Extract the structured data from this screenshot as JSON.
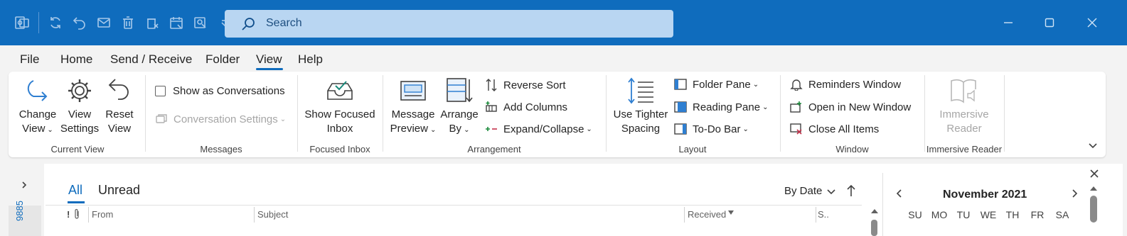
{
  "search": {
    "placeholder": "Search"
  },
  "menu": [
    "File",
    "Home",
    "Send / Receive",
    "Folder",
    "View",
    "Help"
  ],
  "ribbon": {
    "current_view": {
      "change_view": [
        "Change",
        "View"
      ],
      "view_settings": [
        "View",
        "Settings"
      ],
      "reset_view": [
        "Reset",
        "View"
      ],
      "label": "Current View"
    },
    "messages": {
      "show_as_conversations": "Show as Conversations",
      "conversation_settings": "Conversation Settings",
      "label": "Messages"
    },
    "focused_inbox": {
      "show_focused_inbox": [
        "Show Focused",
        "Inbox"
      ],
      "label": "Focused Inbox"
    },
    "arrangement": {
      "message_preview": [
        "Message",
        "Preview"
      ],
      "arrange_by": [
        "Arrange",
        "By"
      ],
      "reverse_sort": "Reverse Sort",
      "add_columns": "Add Columns",
      "expand_collapse": "Expand/Collapse",
      "label": "Arrangement"
    },
    "layout": {
      "use_tighter_spacing": [
        "Use Tighter",
        "Spacing"
      ],
      "folder_pane": "Folder Pane",
      "reading_pane": "Reading Pane",
      "todo_bar": "To-Do Bar",
      "label": "Layout"
    },
    "window": {
      "reminders_window": "Reminders Window",
      "open_new_window": "Open in New Window",
      "close_all_items": "Close All Items",
      "label": "Window"
    },
    "immersive": {
      "immersive_reader": [
        "Immersive",
        "Reader"
      ],
      "label": "Immersive Reader"
    }
  },
  "mail": {
    "tabs": {
      "all": "All",
      "unread": "Unread"
    },
    "sort": {
      "by": "By Date"
    },
    "columns": {
      "importance": "!",
      "from": "From",
      "subject": "Subject",
      "received": "Received",
      "size": "S.."
    },
    "folder_strip_text": "9885"
  },
  "calendar": {
    "month": "November 2021",
    "days": [
      "SU",
      "MO",
      "TU",
      "WE",
      "TH",
      "FR",
      "SA"
    ]
  },
  "colors": {
    "titlebar": "#0f6cbd",
    "accent": "#0f6cbd"
  }
}
